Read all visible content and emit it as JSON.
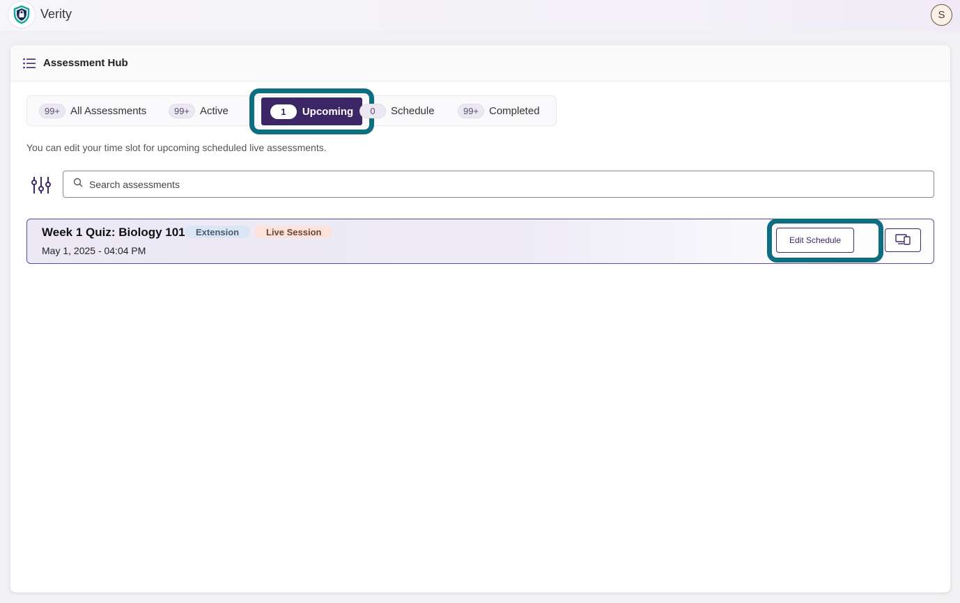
{
  "app": {
    "brand": "Verity",
    "user_initial": "S"
  },
  "hub": {
    "title": "Assessment Hub"
  },
  "tabs": [
    {
      "count": "99+",
      "label": "All Assessments"
    },
    {
      "count": "99+",
      "label": "Active"
    },
    {
      "count": "1",
      "label": "Upcoming",
      "active": true
    },
    {
      "count": "0",
      "label": "Schedule"
    },
    {
      "count": "99+",
      "label": "Completed"
    }
  ],
  "note": "You can edit your time slot for upcoming scheduled live assessments.",
  "search": {
    "placeholder": "Search assessments",
    "value": ""
  },
  "assessments": [
    {
      "title": "Week 1 Quiz: Biology 101",
      "badges": [
        "Extension",
        "Live Session"
      ],
      "date": "May 1, 2025 - 04:04 PM",
      "edit_label": "Edit Schedule"
    }
  ],
  "colors": {
    "accent": "#3d2666",
    "highlight": "#0e6d7f"
  },
  "icons": [
    "shield-lock-icon",
    "list-icon",
    "filter-sliders-icon",
    "search-icon",
    "devices-icon"
  ]
}
